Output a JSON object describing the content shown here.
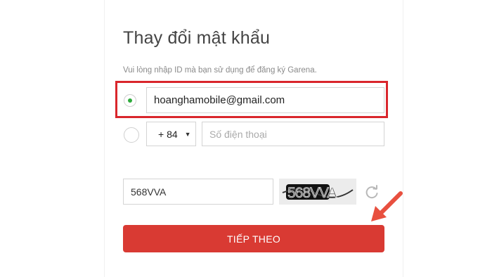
{
  "form": {
    "title": "Thay đổi mật khẩu",
    "hint": "Vui lòng nhập ID mà bạn sử dụng để đăng ký Garena.",
    "email_value": "hoanghamobile@gmail.com",
    "country_code": "+ 84",
    "phone_placeholder": "Số điện thoại",
    "captcha_value": "568VVA",
    "captcha_image_text": "568VVA",
    "submit_label": "TIẾP THEO"
  },
  "colors": {
    "highlight": "#d9262c",
    "button": "#d93a33",
    "radio_selected": "#2eaa3c",
    "arrow": "#e8503f"
  },
  "icons": {
    "refresh": "refresh-icon",
    "caret": "caret-down-icon"
  }
}
